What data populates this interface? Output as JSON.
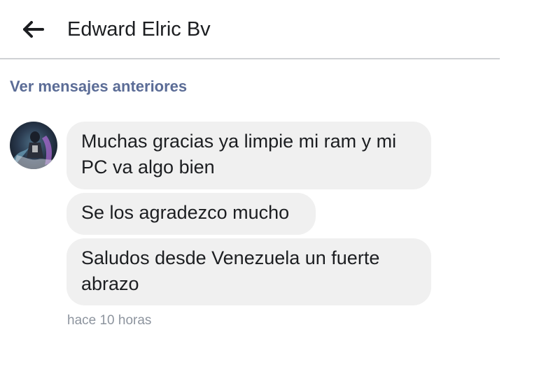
{
  "header": {
    "back_icon": "arrow-left-icon",
    "title": "Edward Elric Bv"
  },
  "thread": {
    "older_messages_link": "Ver mensajes anteriores",
    "sender_avatar": "avatar",
    "messages": [
      {
        "text": "Muchas gracias ya limpie mi ram y mi PC va algo bien"
      },
      {
        "text": "Se los agradezco mucho"
      },
      {
        "text": "Saludos desde Venezuela un fuerte abrazo"
      }
    ],
    "timestamp": "hace 10 horas"
  },
  "colors": {
    "link": "#5b6c96",
    "bubble": "#f0f0f0",
    "timestamp": "#8d949e",
    "divider": "#cfd1d4"
  }
}
